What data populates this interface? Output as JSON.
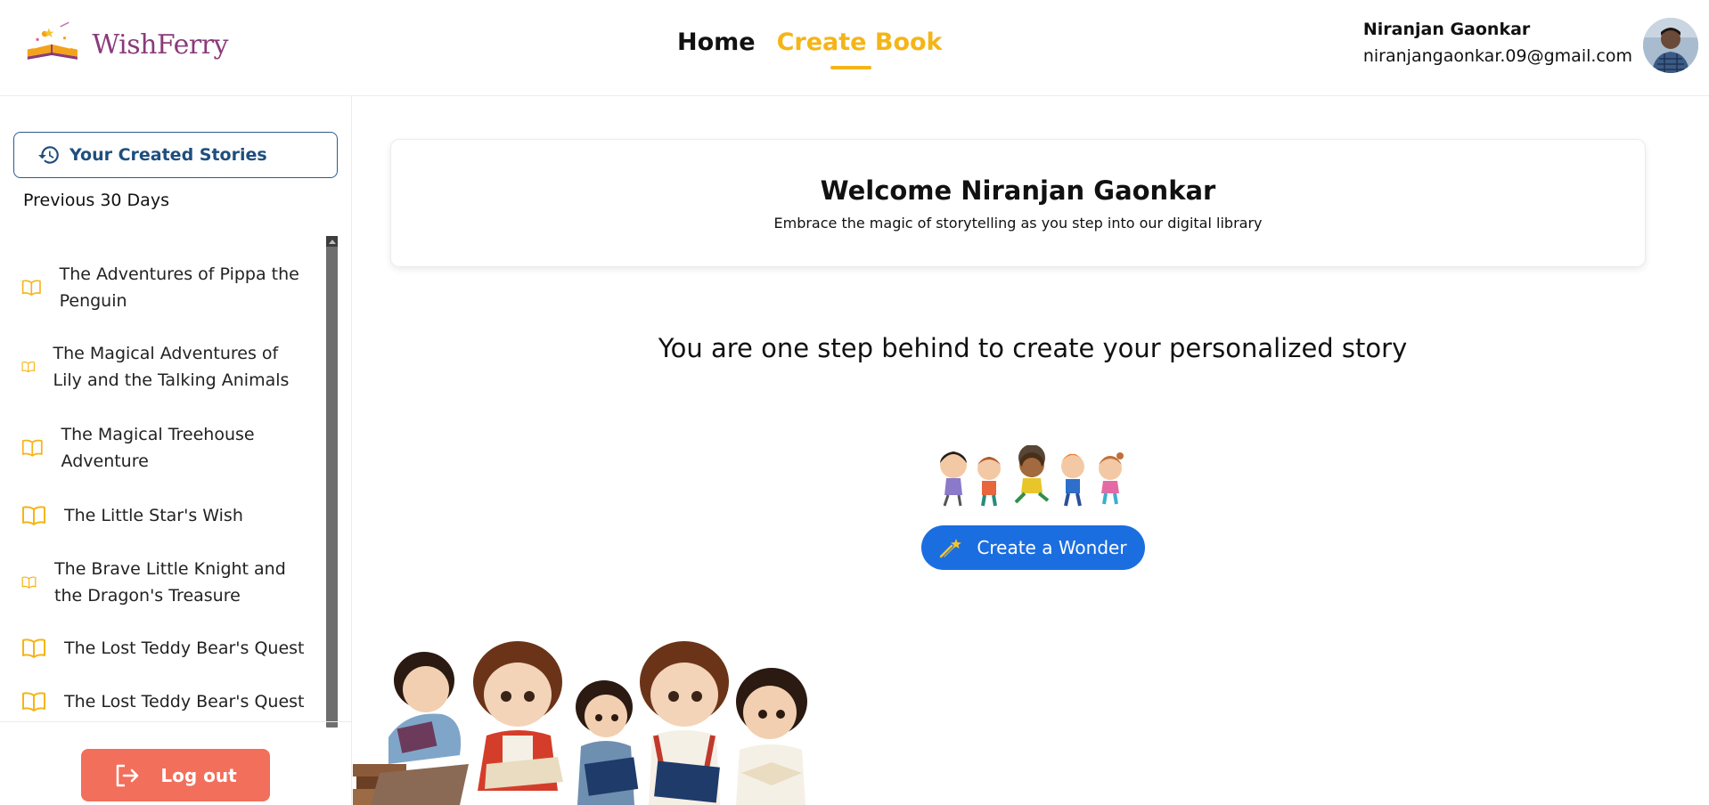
{
  "header": {
    "logo_text": "WishFerry",
    "nav": {
      "home": "Home",
      "create_book": "Create Book"
    },
    "user": {
      "name": "Niranjan Gaonkar",
      "email": "niranjangaonkar.09@gmail.com"
    }
  },
  "sidebar": {
    "stories_button": "Your Created Stories",
    "section_label": "Previous 30 Days",
    "items": [
      {
        "title": "The Adventures of Pippa the Penguin"
      },
      {
        "title": "The Magical Adventures of Lily and the Talking Animals"
      },
      {
        "title": "The Magical Treehouse Adventure"
      },
      {
        "title": "The Little Star's Wish"
      },
      {
        "title": "The Brave Little Knight and the Dragon's Treasure"
      },
      {
        "title": "The Lost Teddy Bear's Quest"
      },
      {
        "title": "The Lost Teddy Bear's Quest"
      }
    ],
    "logout": "Log out"
  },
  "main": {
    "welcome_title": "Welcome Niranjan Gaonkar",
    "welcome_subtitle": "Embrace the magic of storytelling as you step into our digital library",
    "step_text": "You are one step behind to create your personalized story",
    "create_button": "Create a Wonder"
  },
  "colors": {
    "accent": "#f4b517",
    "primary": "#1a6ee0",
    "logout": "#f26f5c",
    "link": "#1f4e7e",
    "brand": "#8a3b7a"
  }
}
